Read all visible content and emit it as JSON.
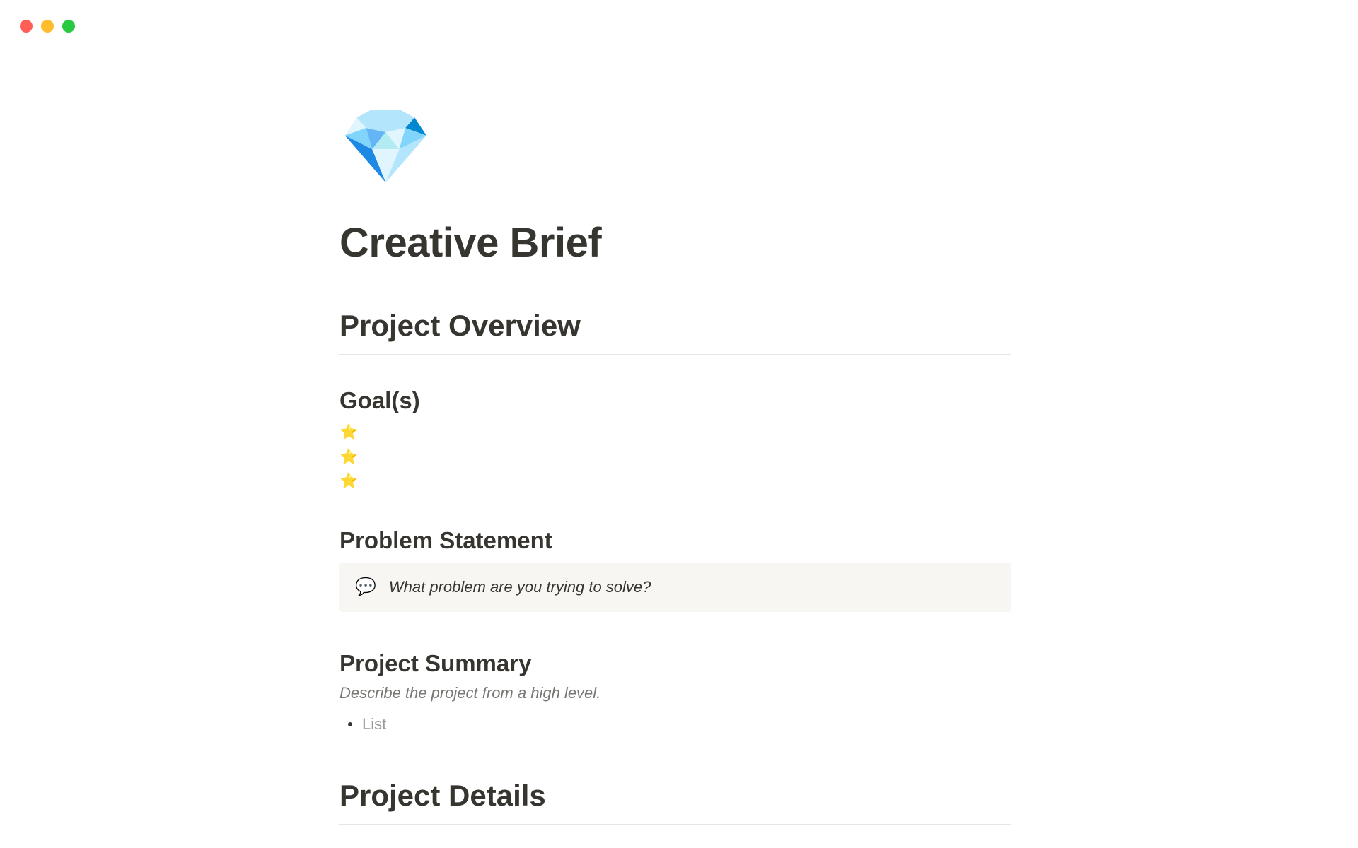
{
  "window": {
    "controls": [
      "close",
      "minimize",
      "maximize"
    ]
  },
  "page": {
    "icon": "💎",
    "title": "Creative Brief"
  },
  "sections": {
    "overview": {
      "heading": "Project Overview"
    },
    "goals": {
      "heading": "Goal(s)",
      "items": [
        "⭐",
        "⭐",
        "⭐"
      ]
    },
    "problem": {
      "heading": "Problem Statement",
      "callout_icon": "💬",
      "callout_text": "What problem are you trying to solve?"
    },
    "summary": {
      "heading": "Project Summary",
      "hint": "Describe the project from a high level.",
      "list_placeholder": "List"
    },
    "details": {
      "heading": "Project Details"
    }
  }
}
